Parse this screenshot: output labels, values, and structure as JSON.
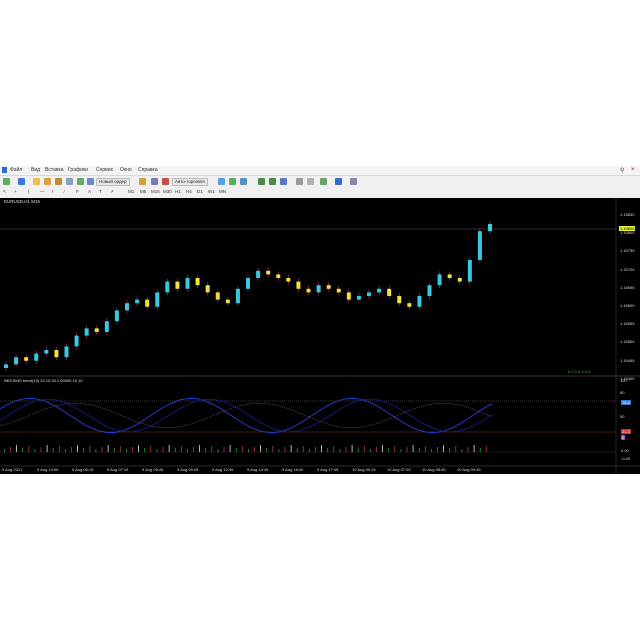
{
  "menu": {
    "items": [
      "Файл",
      "Вид",
      "Вставка",
      "Графики",
      "Сервис",
      "Окно",
      "Справка"
    ]
  },
  "toolbar": {
    "new_order_label": "Новый ордер",
    "autotrading_label": "Авто-торговля",
    "timeframes": [
      "M1",
      "M5",
      "M15",
      "M30",
      "H1",
      "H4",
      "D1",
      "W1",
      "MN"
    ]
  },
  "chart": {
    "title": "EURUSD,H1 M15",
    "price_labels": [
      "1.15830",
      "1.15800",
      "1.15755",
      "1.15700",
      "1.15655",
      "1.15600",
      "1.15555",
      "1.15500",
      "1.15455",
      "1.15400"
    ],
    "current_price": "1.15800",
    "corner_text": "0.2   0   0.3   0.3",
    "time_labels": [
      "9 Aug 2021",
      "9 Aug 13:00",
      "9 Aug 06:15",
      "9 Aug 07:15",
      "9 Aug 08:45",
      "9 Aug 09:45",
      "9 Aug 12:45",
      "9 Aug 14:45",
      "9 Aug 16:00",
      "9 Aug 17:45",
      "10 Aug 09:15",
      "10 Aug 07:00",
      "10 Aug 08:45",
      "10 Aug 09:45"
    ]
  },
  "indicator": {
    "title": "NRCSMO trend(10) 22.10.33 1.00000 10 10",
    "scale_labels": [
      "100",
      "80",
      "50",
      "20",
      "0"
    ],
    "tag_upper": "78.5",
    "tag_lower": "21.3",
    "hist_labels": [
      "0.00",
      "-0.00"
    ]
  },
  "colors": {
    "bull": "#38c9e0",
    "bear": "#f0e040",
    "wick": "#c23a6a",
    "line_blue": "#2b3cd8",
    "line_dark": "#1a1a8a",
    "signal": "#8a8a8a"
  },
  "chart_data": {
    "type": "candlestick",
    "title": "EURUSD,H1 M15",
    "ylim": [
      1.154,
      1.1585
    ],
    "series": [
      {
        "name": "",
        "values": [
          1.1541,
          1.1543,
          1.1542,
          1.1544,
          1.1545,
          1.1543,
          1.1546,
          1.1549,
          1.1551,
          1.155,
          1.1553,
          1.1556,
          1.1558,
          1.1559,
          1.1557,
          1.1561,
          1.1564,
          1.1562,
          1.1565,
          1.1563,
          1.1561,
          1.1559,
          1.1558,
          1.1562,
          1.1565,
          1.1567,
          1.1566,
          1.1565,
          1.1564,
          1.1562,
          1.1561,
          1.1563,
          1.1562,
          1.1561,
          1.1559,
          1.156,
          1.1561,
          1.1562,
          1.156,
          1.1558,
          1.1557,
          1.156,
          1.1563,
          1.1566,
          1.1565,
          1.1564,
          1.157,
          1.1578,
          1.158
        ]
      }
    ]
  }
}
